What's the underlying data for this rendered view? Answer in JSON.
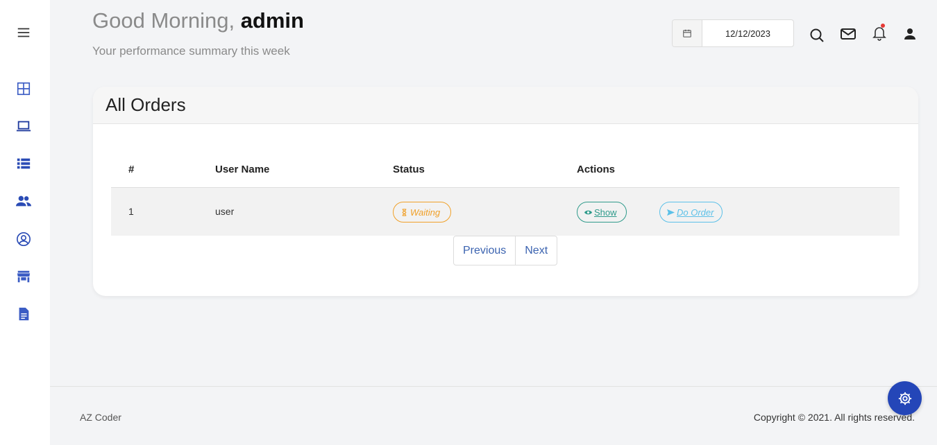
{
  "greeting": {
    "prefix": "Good Morning,",
    "user": "admin",
    "subtitle": "Your performance summary this week"
  },
  "header": {
    "date_value": "12/12/2023"
  },
  "sidebar": {
    "icons": [
      "menu-icon",
      "dashboard-grid-icon",
      "laptop-icon",
      "list-icon",
      "users-icon",
      "account-circle-icon",
      "store-icon",
      "document-icon"
    ]
  },
  "orders": {
    "title": "All Orders",
    "columns": [
      "#",
      "User Name",
      "Status",
      "Actions"
    ],
    "rows": [
      {
        "id": "1",
        "user": "user",
        "status": "Waiting",
        "show": "Show",
        "do_order": "Do Order"
      }
    ]
  },
  "pagination": {
    "previous": "Previous",
    "next": "Next"
  },
  "footer": {
    "left": "AZ Coder",
    "right": "Copyright © 2021. All rights reserved."
  },
  "colors": {
    "accent": "#2446b8",
    "waiting": "#f0a028",
    "show": "#2e9a8a",
    "order": "#5bc0e8"
  }
}
